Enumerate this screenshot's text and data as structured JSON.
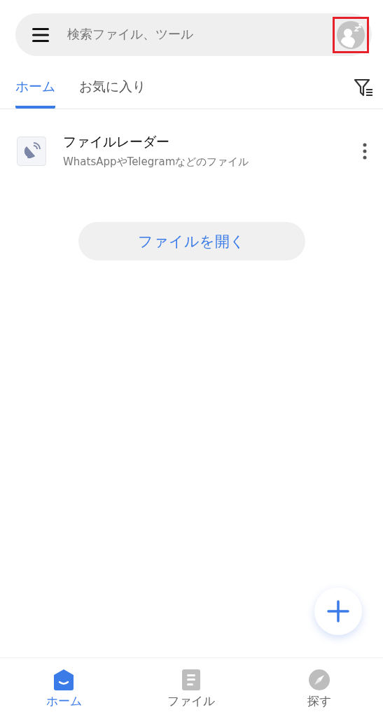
{
  "search": {
    "placeholder": "検索ファイル、ツール",
    "avatar_highlighted": true
  },
  "tabs": [
    {
      "label": "ホーム",
      "selected": true
    },
    {
      "label": "お気に入り",
      "selected": false
    }
  ],
  "items": [
    {
      "title": "ファイルレーダー",
      "subtitle": "WhatsAppやTelegramなどのファイル"
    }
  ],
  "open_button": "ファイルを開く",
  "bottom_nav": [
    {
      "label": "ホーム",
      "kind": "home",
      "selected": true
    },
    {
      "label": "ファイル",
      "kind": "file",
      "selected": false
    },
    {
      "label": "探す",
      "kind": "explore",
      "selected": false
    }
  ]
}
